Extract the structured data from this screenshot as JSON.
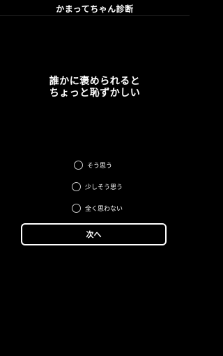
{
  "header": {
    "title": "かまってちゃん診断"
  },
  "question": {
    "lines": [
      "誰かに褒められると",
      "ちょっと恥ずかしい"
    ]
  },
  "options": [
    {
      "label": "そう思う",
      "selected": false
    },
    {
      "label": "少しそう思う",
      "selected": false
    },
    {
      "label": "全く思わない",
      "selected": false
    }
  ],
  "next_button": {
    "label": "次へ"
  },
  "colors": {
    "background": "#000000",
    "text": "#ffffff",
    "radio_border": "#cfcfcf"
  }
}
